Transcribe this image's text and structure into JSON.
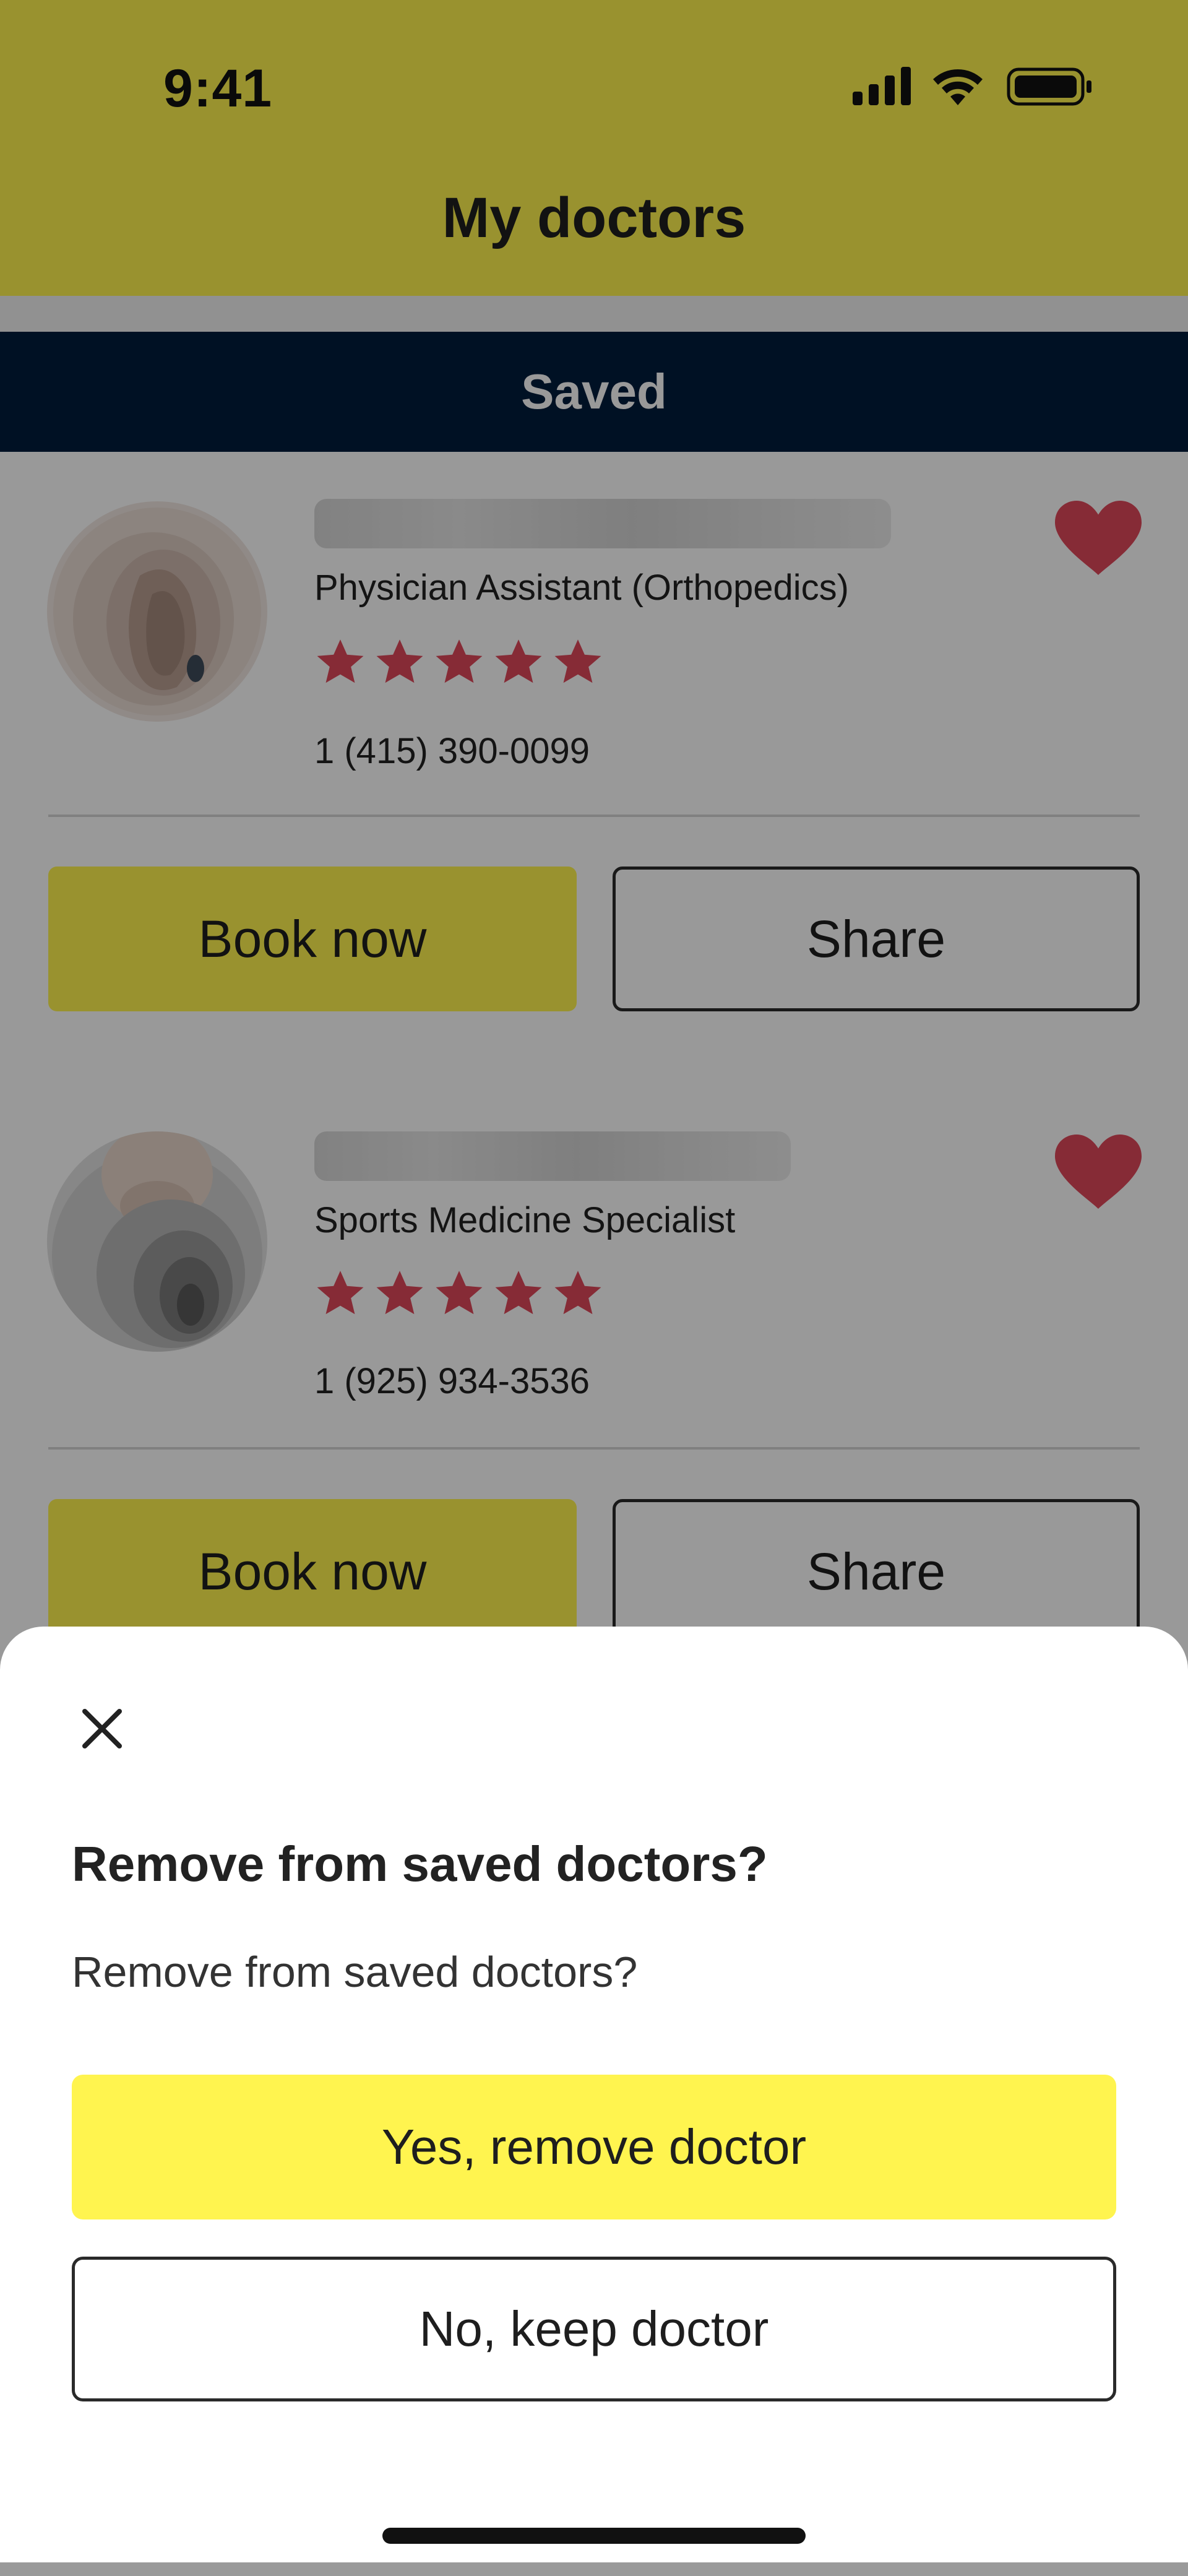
{
  "status_bar": {
    "time": "9:41",
    "icons": [
      "signal-icon",
      "wifi-icon",
      "battery-icon"
    ]
  },
  "header": {
    "title": "My doctors"
  },
  "tabs": {
    "active_label": "Saved"
  },
  "doctors": [
    {
      "specialty": "Physician Assistant (Orthopedics)",
      "rating": 5,
      "phone": "1 (415) 390-0099",
      "saved": true,
      "book_label": "Book now",
      "share_label": "Share"
    },
    {
      "specialty": "Sports Medicine Specialist",
      "rating": 5,
      "phone": "1 (925) 934-3536",
      "saved": true,
      "book_label": "Book now",
      "share_label": "Share"
    }
  ],
  "dialog": {
    "title": "Remove from saved doctors?",
    "body": "Remove from saved doctors?",
    "confirm_label": "Yes, remove doctor",
    "cancel_label": "No, keep doctor",
    "close_icon": "close-icon"
  },
  "colors": {
    "brand_yellow": "#fff44f",
    "tab_navy": "#001d3d",
    "heart_red": "#e0485a",
    "star_red": "#e0485a",
    "overlay": "rgba(0,0,0,0.40)"
  }
}
